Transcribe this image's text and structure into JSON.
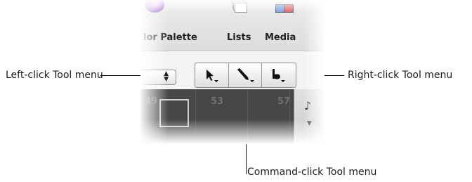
{
  "toolbar": {
    "color_palette_label": "lor Palette",
    "lists_label": "Lists",
    "media_label": "Media"
  },
  "ruler": {
    "numbers": [
      "49",
      "53",
      "57"
    ]
  },
  "callouts": {
    "left": "Left-click Tool menu",
    "right": "Right-click Tool menu",
    "command": "Command-click Tool menu"
  },
  "tools": {
    "left": "pointer-tool-icon",
    "command": "pencil-tool-icon",
    "right": "scissors-tool-icon"
  }
}
